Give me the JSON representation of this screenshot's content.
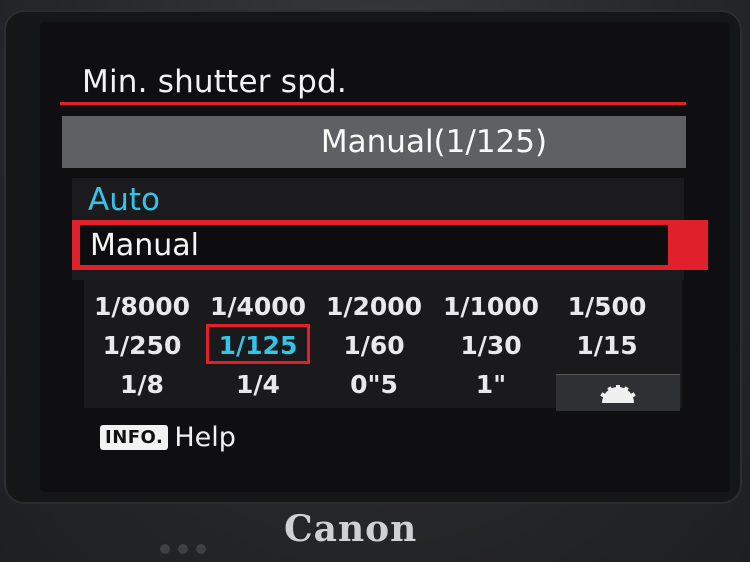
{
  "menu": {
    "title": "Min. shutter spd.",
    "current_setting": "Manual(1/125)",
    "options": [
      "Auto",
      "Manual"
    ],
    "selected_option": "Manual"
  },
  "shutter_speeds": {
    "row1": [
      "1/8000",
      "1/4000",
      "1/2000",
      "1/1000",
      "1/500"
    ],
    "row2": [
      "1/250",
      "1/125",
      "1/60",
      "1/30",
      "1/15"
    ],
    "row3": [
      "1/8",
      "1/4",
      "0\"5",
      "1\""
    ],
    "selected": "1/125"
  },
  "help": {
    "button_label": "INFO.",
    "text": "Help"
  },
  "brand": "Canon",
  "colors": {
    "accent_red": "#e0202a",
    "highlight_cyan": "#33c4e8"
  },
  "icons": {
    "dial": "main-dial-icon"
  }
}
